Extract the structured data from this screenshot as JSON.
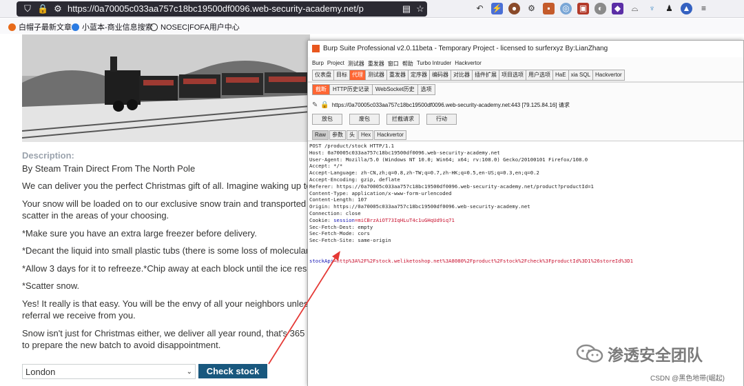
{
  "browser": {
    "url_prefix": "https://0a70005c033aa757c18bc19500df0096.",
    "url_host": "web-security-academy.net",
    "url_suffix": "/product?productId",
    "bookmarks": [
      {
        "label": "白帽子最新文章",
        "color": "#e86b1a"
      },
      {
        "label": "小蓝本-商业信息搜索",
        "color": "#2a7ae2"
      },
      {
        "label": "NOSEC|FOFA用户中心",
        "color": "#333333"
      }
    ]
  },
  "site": {
    "description_label": "Description:",
    "paragraphs": [
      "By Steam Train Direct From The North Pole",
      "We can deliver you the perfect Christmas gift of all. Imagine waking up to t",
      "Your snow will be loaded on to our exclusive snow train and transported ac",
      "scatter in the areas of your choosing.",
      "*Make sure you have an extra large freezer before delivery.",
      "*Decant the liquid into small plastic tubs (there is some loss of molecular s",
      "*Allow 3 days for it to refreeze.*Chip away at each block until the ice resen",
      "*Scatter snow.",
      "Yes! It really is that easy. You will be the envy of all your neighbors unless",
      "referral we receive from you.",
      "Snow isn't just for Christmas either, we deliver all year round, that's 365 da",
      "to prepare the new batch to avoid disappointment."
    ],
    "store_value": "London",
    "check_stock_label": "Check stock"
  },
  "burp": {
    "title": "Burp Suite Professional v2.0.11beta - Temporary Project - licensed to surferxyz By:LianZhang",
    "menu": [
      "Burp",
      "Project",
      "测试器",
      "重发器",
      "窗口",
      "帮助",
      "Turbo Intruder",
      "Hackvertor"
    ],
    "tabs": [
      "仪表盘",
      "目标",
      "代理",
      "测试器",
      "重发器",
      "定序器",
      "编码器",
      "对比器",
      "插件扩展",
      "项目选项",
      "用户选项",
      "HaE",
      "xia SQL",
      "Hackvertor"
    ],
    "sub_tabs": [
      "截断",
      "HTTP历史记录",
      "WebSocket历史",
      "选项"
    ],
    "request_info": "https://0a70005c033aa757c18bc19500df0096.web-security-academy.net:443  [79.125.84.16] 请求",
    "actions": [
      "放包",
      "废包",
      "拦截请求",
      "行动"
    ],
    "view_tabs": [
      "Raw",
      "参数",
      "头",
      "Hex",
      "Hackvertor"
    ],
    "request_lines": [
      "POST /product/stock HTTP/1.1",
      "Host: 0a70005c033aa757c18bc19500df0096.web-security-academy.net",
      "User-Agent: Mozilla/5.0 (Windows NT 10.0; Win64; x64; rv:108.0) Gecko/20100101 Firefox/108.0",
      "Accept: */*",
      "Accept-Language: zh-CN,zh;q=0.8,zh-TW;q=0.7,zh-HK;q=0.5,en-US;q=0.3,en;q=0.2",
      "Accept-Encoding: gzip, deflate",
      "Referer: https://0a70005c033aa757c18bc19500df0096.web-security-academy.net/product?productId=1",
      "Content-Type: application/x-www-form-urlencoded",
      "Content-Length: 107",
      "Origin: https://0a70005c033aa757c18bc19500df0096.web-security-academy.net",
      "Connection: close"
    ],
    "cookie_key": "Cookie: ",
    "cookie_name": "session",
    "cookie_value": "=miCBrzAiOT73IqHLuT4c1uGHqUd9iq71",
    "request_lines_2": [
      "Sec-Fetch-Dest: empty",
      "Sec-Fetch-Mode: cors",
      "Sec-Fetch-Site: same-origin"
    ],
    "body_key": "stockApi",
    "body_value": "=http%3A%2F%2Fstock.weliketoshop.net%3A8080%2Fproduct%2Fstock%2Fcheck%3FproductId%3D1%26storeId%3D1"
  },
  "watermark": {
    "text": "渗透安全团队",
    "credit": "CSDN @黑色地带(崛起)"
  },
  "colors": {
    "burp_accent": "#ff6633",
    "check_button": "#19587e",
    "arrow": "#e53935"
  }
}
